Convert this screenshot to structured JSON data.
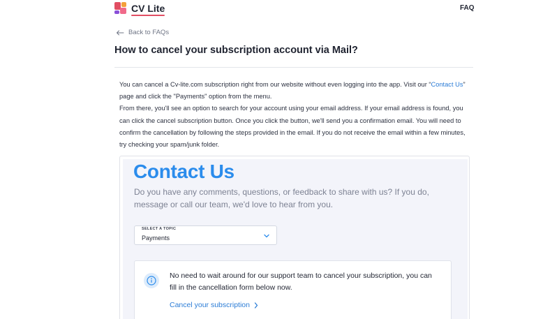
{
  "header": {
    "brand": "CV Lite",
    "faq_label": "FAQ"
  },
  "nav": {
    "back_label": "Back to FAQs"
  },
  "article": {
    "title": "How to cancel your subscription account via Mail?",
    "para1_before": "You can cancel a Cv-lite.com subscription right from our website without even logging into the app. Visit our “",
    "para1_link": "Contact Us",
    "para1_after": "” page and click the \"Payments\" option from the menu.",
    "para2": "From there, you'll see an option to search for your account using your email address. If your email address is found, you can click the cancel subscription button. Once you click the button, we'll send you a confirmation email. You will need to confirm the cancellation by following the steps provided in the email. If you do not receive the email within a few minutes, try checking your spam/junk folder."
  },
  "embed": {
    "title": "Contact Us",
    "subtitle": "Do you have any comments, questions, or feedback to share with us? If you do, message or call our team, we'd love to hear from you.",
    "select_label": "SELECT A TOPIC",
    "select_value": "Payments",
    "notice_text": "No need to wait around for our support team to cancel your subscription, you can fill in the cancellation form below now.",
    "cancel_link": "Cancel your subscription"
  },
  "colors": {
    "accent_blue": "#2b8cec",
    "link_blue": "#2b7cd6",
    "brand_red": "#e14e63"
  },
  "icons": {
    "logo": "cv-lite-logo-icon",
    "back": "arrow-left-icon",
    "select": "chevron-down-icon",
    "notice": "info-icon",
    "link": "chevron-right-icon"
  }
}
